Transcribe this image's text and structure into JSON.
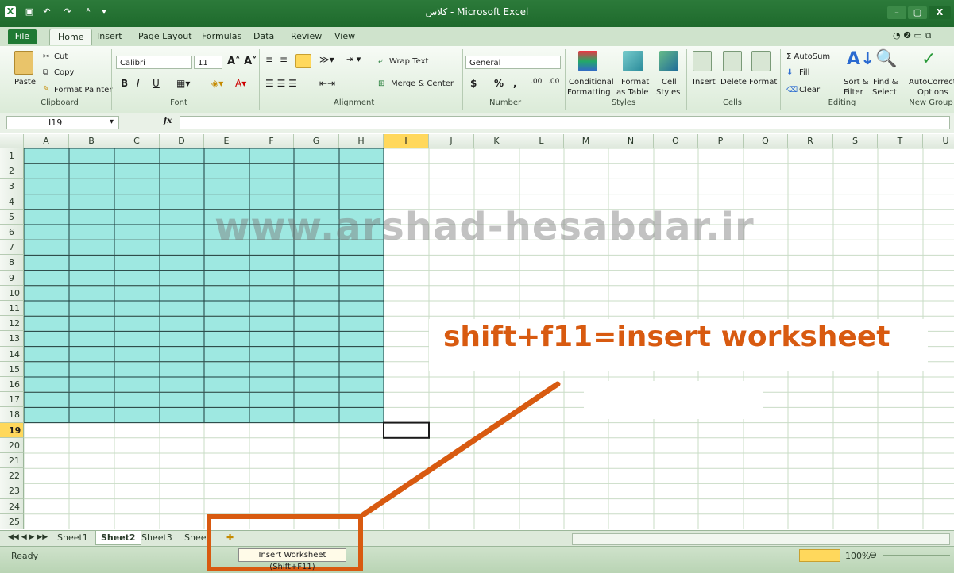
{
  "window": {
    "title": "کلاس - Microsoft Excel",
    "controls": [
      "–",
      "▢",
      "X"
    ]
  },
  "quick_access": [
    "X",
    "💾",
    "↶",
    "↷",
    "ᴬ",
    "▾"
  ],
  "tabs": [
    "File",
    "Home",
    "Insert",
    "Page Layout",
    "Formulas",
    "Data",
    "Review",
    "View"
  ],
  "active_tab": "Home",
  "ribbon": {
    "clipboard": {
      "paste": "Paste",
      "cut": "Cut",
      "copy": "Copy",
      "format_painter": "Format Painter",
      "label": "Clipboard"
    },
    "font": {
      "name": "Calibri",
      "size": "11",
      "bold": "B",
      "italic": "I",
      "underline": "U",
      "label": "Font"
    },
    "alignment": {
      "wrap_text": "Wrap Text",
      "merge_center": "Merge & Center",
      "label": "Alignment"
    },
    "number": {
      "format": "General",
      "currency": "$",
      "percent": "%",
      "comma": ",",
      "inc_decimal": ".00",
      "dec_decimal": ".00",
      "label": "Number"
    },
    "styles": {
      "conditional": "Conditional",
      "conditional2": "Formatting",
      "format_as": "Format",
      "format_as2": "as Table",
      "cell": "Cell",
      "cell2": "Styles",
      "label": "Styles"
    },
    "cells": {
      "insert": "Insert",
      "delete": "Delete",
      "format": "Format",
      "label": "Cells"
    },
    "editing": {
      "autosum": "Σ AutoSum",
      "fill": "Fill",
      "clear": "Clear",
      "sort": "Sort &",
      "sort2": "Filter",
      "find": "Find &",
      "find2": "Select",
      "label": "Editing"
    },
    "new_group": {
      "autocorrect": "AutoCorrect",
      "options": "Options",
      "label": "New Group"
    }
  },
  "formula_bar": {
    "name_box": "I19",
    "fx": "fx",
    "value": ""
  },
  "columns": [
    "A",
    "B",
    "C",
    "D",
    "E",
    "F",
    "G",
    "H",
    "I",
    "J",
    "K",
    "L",
    "M",
    "N",
    "O",
    "P",
    "Q",
    "R",
    "S",
    "T",
    "U"
  ],
  "rows": [
    "1",
    "2",
    "3",
    "4",
    "5",
    "6",
    "7",
    "8",
    "9",
    "10",
    "11",
    "12",
    "13",
    "14",
    "15",
    "16",
    "17",
    "18",
    "19",
    "20",
    "21",
    "22",
    "23",
    "24",
    "25"
  ],
  "active_cell": {
    "column": "I",
    "row": "19"
  },
  "filled_range": {
    "from": "A1",
    "to": "H18",
    "color": "#9ee8e1"
  },
  "sheets": [
    "Sheet1",
    "Sheet2",
    "Sheet3",
    "Sheet"
  ],
  "active_sheet": "Sheet2",
  "status": {
    "ready": "Ready",
    "zoom": "100%"
  },
  "tooltip": "Insert Worksheet (Shift+F11)",
  "watermark": "www.arshad-hesabdar.ir",
  "annotation": "shift+f11=insert worksheet",
  "colors": {
    "accent": "#d85a10",
    "fill": "#9ee8e1",
    "excel_green": "#1f7a34",
    "selected_header": "#ffd85c"
  }
}
